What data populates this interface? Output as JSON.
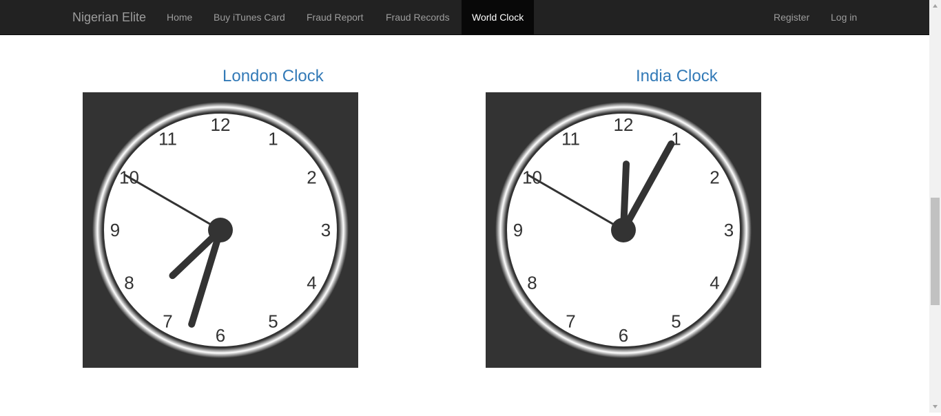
{
  "navbar": {
    "brand": "Nigerian Elite",
    "items": [
      {
        "label": "Home"
      },
      {
        "label": "Buy iTunes Card"
      },
      {
        "label": "Fraud Report"
      },
      {
        "label": "Fraud Records"
      },
      {
        "label": "World Clock"
      }
    ],
    "right_items": [
      {
        "label": "Register"
      },
      {
        "label": "Log in"
      }
    ]
  },
  "clocks": [
    {
      "title": "London Clock",
      "numbers": [
        "12",
        "1",
        "2",
        "3",
        "4",
        "5",
        "6",
        "7",
        "8",
        "9",
        "10",
        "11"
      ],
      "time": {
        "hour": 7,
        "minute": 32,
        "second": 50
      }
    },
    {
      "title": "India Clock",
      "numbers": [
        "12",
        "1",
        "2",
        "3",
        "4",
        "5",
        "6",
        "7",
        "8",
        "9",
        "10",
        "11"
      ],
      "time": {
        "hour": 12,
        "minute": 4,
        "second": 50
      }
    }
  ],
  "colors": {
    "navbar_bg": "#222222",
    "nav_text": "#9d9d9d",
    "nav_active_bg": "#080808",
    "title_color": "#337ab7",
    "clock_bg": "#333333"
  }
}
